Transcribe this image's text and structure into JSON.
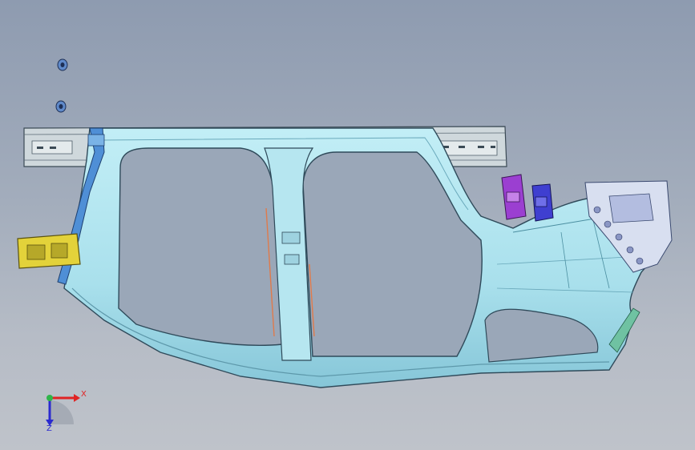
{
  "app": {
    "view": "3d-model-viewport"
  },
  "colors": {
    "background_top": "#8e9bb0",
    "background_bottom": "#bfc3ca",
    "body_panel": "#a9e0ec",
    "body_panel_shade": "#86c6d8",
    "outline": "#2f4a5a",
    "reinforcement_blue": "#4f8fd6",
    "bracket_yellow": "#e3d23a",
    "bracket_purple": "#9b3fd1",
    "bracket_blue": "#3f3fd0",
    "bolt_blue": "#5f89c9",
    "axis_x": "#e02424",
    "axis_y": "#2fb54a",
    "axis_z": "#2a2acf"
  },
  "axes": {
    "x_label": "X",
    "z_label": "Z"
  },
  "icons": {
    "triad": "axis-triad-icon",
    "bolt": "bolt-icon"
  }
}
